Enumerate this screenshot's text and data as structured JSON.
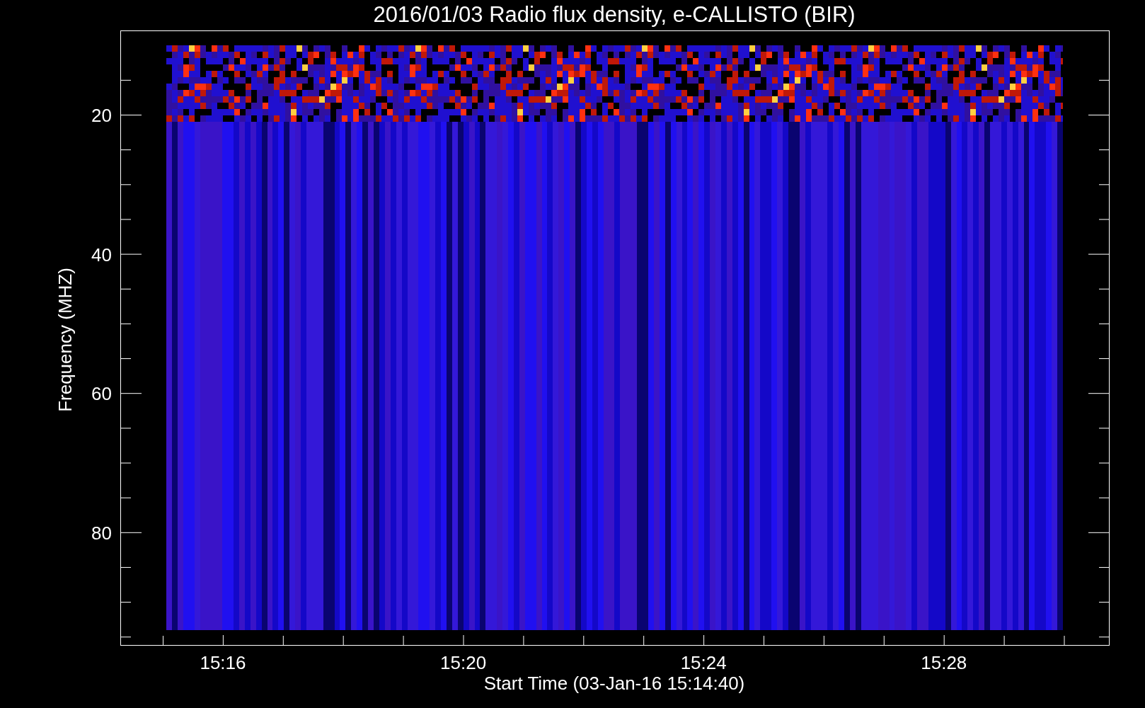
{
  "title": "2016/01/03  Radio flux density, e-CALLISTO (BIR)",
  "y_axis": {
    "label": "Frequency (MHZ)",
    "ticks": [
      "20",
      "40",
      "60",
      "80"
    ]
  },
  "x_axis": {
    "label": "Start Time (03-Jan-16 15:14:40)",
    "ticks": [
      "15:16",
      "15:20",
      "15:24",
      "15:28"
    ]
  }
}
